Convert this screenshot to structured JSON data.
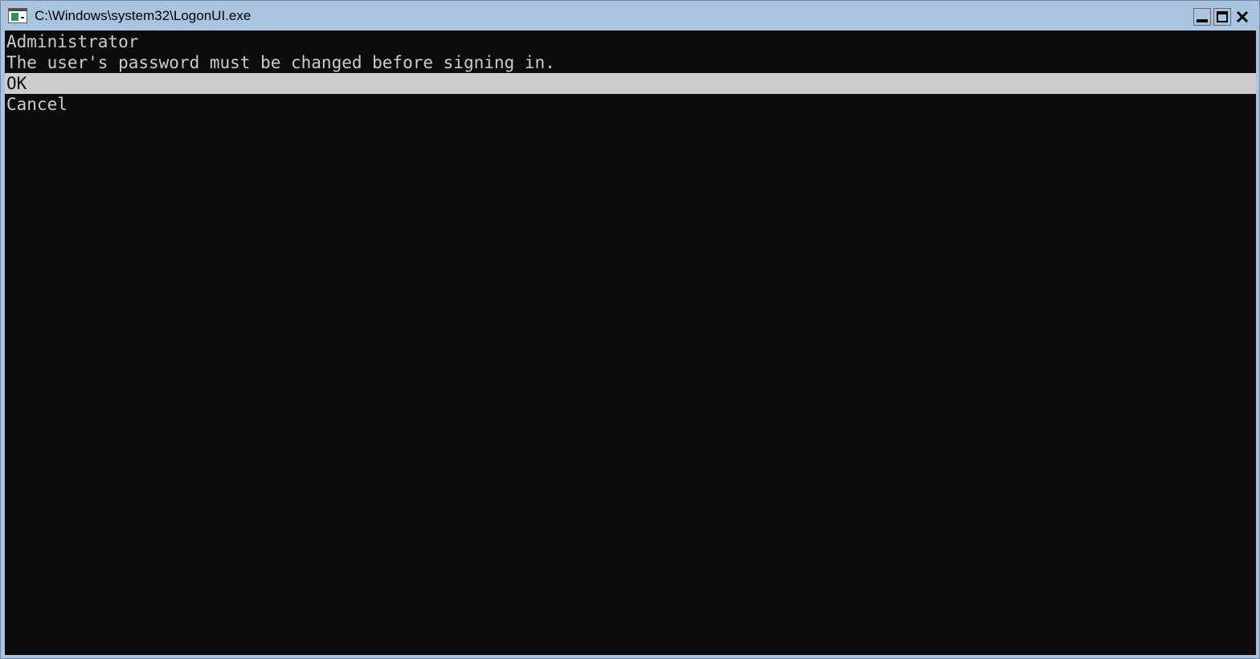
{
  "window": {
    "title": "C:\\Windows\\system32\\LogonUI.exe",
    "icon": "console-app-icon",
    "controls": {
      "minimize": "minimize-icon",
      "maximize": "maximize-icon",
      "close": "close-icon"
    }
  },
  "console": {
    "username": "Administrator",
    "message": "The user's password must be changed before signing in.",
    "options": [
      {
        "label": "OK",
        "selected": true
      },
      {
        "label": "Cancel",
        "selected": false
      }
    ]
  },
  "colors": {
    "titlebar": "#a9c4df",
    "console_bg": "#0c0c0c",
    "console_fg": "#cccccc",
    "selection_bg": "#cccccc"
  }
}
